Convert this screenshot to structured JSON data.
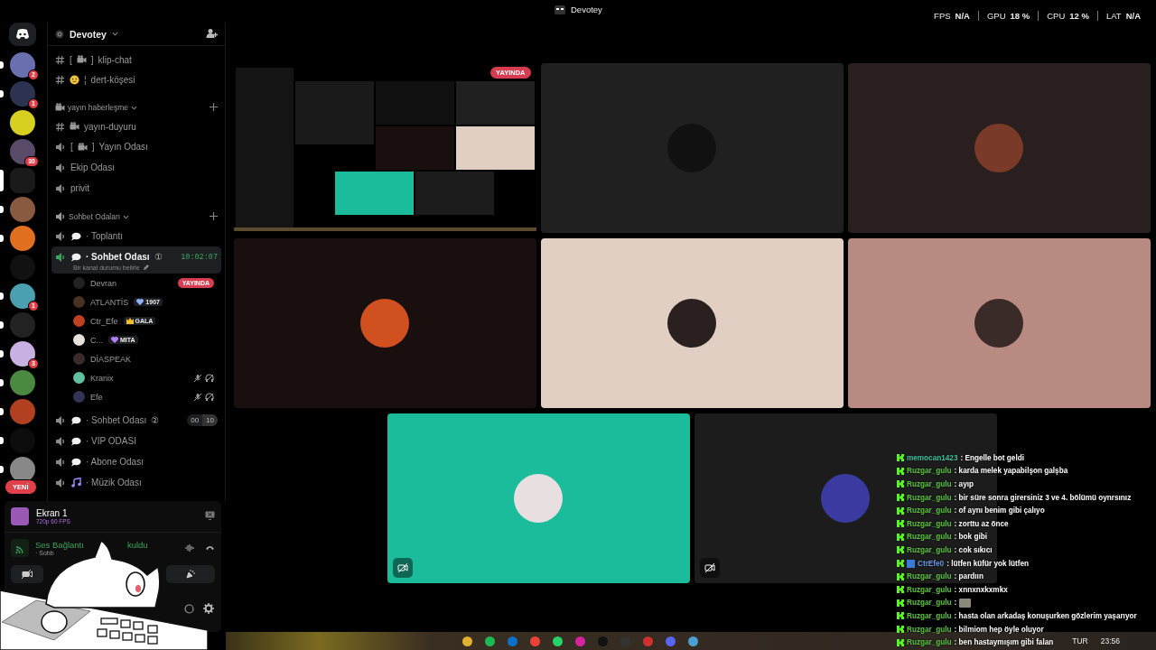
{
  "title_bar": {
    "title": "Devotey",
    "stats": [
      {
        "label": "FPS",
        "value": "N/A"
      },
      {
        "label": "GPU",
        "value": "18 %"
      },
      {
        "label": "CPU",
        "value": "12 %"
      },
      {
        "label": "LAT",
        "value": "N/A"
      }
    ]
  },
  "servers": [
    {
      "color": "#6a6fb0",
      "badge": "2",
      "unread": true,
      "selected": false
    },
    {
      "color": "#2b3350",
      "badge": "1",
      "unread": true,
      "selected": false
    },
    {
      "color": "#d8d020",
      "unread": false,
      "selected": false
    },
    {
      "color": "#5a4a6a",
      "badge": "30",
      "unread": false,
      "selected": false
    },
    {
      "color": "#1a1a1a",
      "unread": false,
      "selected": true
    },
    {
      "color": "#8a5a40",
      "unread": true,
      "selected": false
    },
    {
      "color": "#e07020",
      "unread": true,
      "selected": false
    },
    {
      "color": "#111111",
      "unread": false,
      "selected": false
    },
    {
      "color": "#4aa0b0",
      "badge": "1",
      "unread": true,
      "selected": false
    },
    {
      "color": "#222222",
      "unread": true,
      "selected": false
    },
    {
      "color": "#c8b0e0",
      "badge": "3",
      "unread": true,
      "selected": false
    },
    {
      "color": "#4a8a40",
      "unread": true,
      "selected": false
    },
    {
      "color": "#b04020",
      "unread": true,
      "selected": false
    },
    {
      "color": "#0c0c0c",
      "unread": true,
      "selected": false
    },
    {
      "color": "#888888",
      "unread": true,
      "selected": false
    }
  ],
  "new_label": "YENİ",
  "server": {
    "name": "Devotey"
  },
  "channels": [
    {
      "kind": "text",
      "prefix": "[",
      "emblem": {
        "kind": "camera"
      },
      "infix": "]",
      "name": "klip-chat"
    },
    {
      "kind": "text",
      "emblem": {
        "kind": "smiley"
      },
      "infix": "¦",
      "name": "dert-köşesi"
    },
    {
      "kind": "category",
      "emblem": {
        "kind": "camera"
      },
      "name": "yayın haberleşme",
      "expanded": true
    },
    {
      "kind": "text",
      "emblem": {
        "kind": "camera"
      },
      "name": "yayın-duyuru"
    },
    {
      "kind": "voice",
      "prefix": "[",
      "emblem": {
        "kind": "camera"
      },
      "infix": "]",
      "name": "Yayın Odası",
      "selected": false
    },
    {
      "kind": "voice",
      "name": "Ekip Odası",
      "selected": false
    },
    {
      "kind": "voice",
      "name": "privit",
      "selected": false
    },
    {
      "kind": "category",
      "emblem": {
        "kind": "speaker"
      },
      "name": "Sohbet Odaları",
      "expanded": true
    },
    {
      "kind": "voice",
      "emblem": {
        "kind": "chat"
      },
      "name": "· Toplantı",
      "selected": false
    },
    {
      "kind": "voice",
      "emblem": {
        "kind": "chat"
      },
      "name": "· Sohbet Odası",
      "mark": "①",
      "timer": "10:02:07",
      "status": "Bir kanal durumu belirle",
      "selected": true
    },
    {
      "kind": "user",
      "name": "Devran",
      "live": "YAYINDA",
      "muted": false,
      "deafened": false
    },
    {
      "kind": "user",
      "name": "ATLANTİS",
      "tag": "1907",
      "tag_emblem": {
        "kind": "heart",
        "color": "#8fb0ff"
      },
      "muted": false,
      "deafened": false
    },
    {
      "kind": "user",
      "name": "Ctr_Efe",
      "tag": "GALA",
      "tag_emblem": {
        "kind": "crown",
        "color": "#f0c030"
      },
      "muted": false,
      "deafened": false
    },
    {
      "kind": "user",
      "name": "C...",
      "tag": "MITA",
      "tag_emblem": {
        "kind": "heart",
        "color": "#b080ff"
      },
      "muted": false,
      "deafened": false
    },
    {
      "kind": "user",
      "name": "DİASPEAK",
      "muted": false,
      "deafened": false
    },
    {
      "kind": "user",
      "name": "Kranix",
      "muted": true,
      "deafened": true
    },
    {
      "kind": "user",
      "name": "Efe",
      "muted": true,
      "deafened": true
    },
    {
      "kind": "voice",
      "emblem": {
        "kind": "chat"
      },
      "name": "· Sohbet Odası",
      "mark": "②",
      "counts": [
        "00",
        "10"
      ],
      "selected": false
    },
    {
      "kind": "voice",
      "emblem": {
        "kind": "chat"
      },
      "name": "· VIP ODASI",
      "selected": false
    },
    {
      "kind": "voice",
      "emblem": {
        "kind": "chat"
      },
      "name": "· Abone Odası",
      "selected": false
    },
    {
      "kind": "voice",
      "emblem": {
        "kind": "music"
      },
      "name": "· Müzik Odası",
      "selected": false
    }
  ],
  "stream_panel": {
    "title": "Ekran 1",
    "quality": "720p 60 FPS"
  },
  "voice_panel": {
    "status_start": "Ses Bağlantı",
    "status_end": "kuldu",
    "channel": "· Sohb"
  },
  "tiles": [
    {
      "kind": "screen",
      "live": "YAYINDA",
      "camera_off": false
    },
    {
      "kind": "avatar",
      "color": "#202020",
      "avatar": {
        "color": "#111111"
      },
      "camera_off": false
    },
    {
      "kind": "avatar",
      "color": "#2a1f1f",
      "avatar": {
        "color": "#7a3a2a"
      },
      "camera_off": false
    },
    {
      "kind": "avatar",
      "color": "#1a0f0f",
      "avatar": {
        "color": "#d05020"
      },
      "camera_off": false
    },
    {
      "kind": "avatar",
      "color": "#e2cfc4",
      "avatar": {
        "color": "#2a2020"
      },
      "camera_off": false
    },
    {
      "kind": "avatar",
      "color": "#b98a82",
      "avatar": {
        "color": "#3a2a28"
      },
      "camera_off": false
    },
    {
      "kind": "avatar",
      "color": "#1abc9c",
      "avatar": {
        "color": "#e8e0e0"
      },
      "camera_off": true
    },
    {
      "kind": "avatar",
      "color": "#1c1c1c",
      "avatar": {
        "color": "#3a3aa0"
      },
      "camera_off": true
    }
  ],
  "chat": [
    {
      "user": "memocan1423",
      "color": "#40c0a0",
      "mod": false,
      "text": ": Engelle bot geldi"
    },
    {
      "user": "Ruzgar_gulu",
      "color": "#5cc83c",
      "mod": false,
      "text": ": karda melek yapabilşon galşba"
    },
    {
      "user": "Ruzgar_gulu",
      "color": "#5cc83c",
      "mod": false,
      "text": ": ayıp"
    },
    {
      "user": "Ruzgar_gulu",
      "color": "#5cc83c",
      "mod": false,
      "text": ": bir süre sonra girersiniz 3 ve 4. bölümü oynrsınız"
    },
    {
      "user": "Ruzgar_gulu",
      "color": "#5cc83c",
      "mod": false,
      "text": ": of aynı benim gibi çalıyo"
    },
    {
      "user": "Ruzgar_gulu",
      "color": "#5cc83c",
      "mod": false,
      "text": ": zorttu az önce"
    },
    {
      "user": "Ruzgar_gulu",
      "color": "#5cc83c",
      "mod": false,
      "text": ": bok gibi"
    },
    {
      "user": "Ruzgar_gulu",
      "color": "#5cc83c",
      "mod": false,
      "text": ": cok sıkıcı"
    },
    {
      "user": "CtrEfe0",
      "color": "#6a9ae8",
      "mod": true,
      "text": ": lütfen küfür yok lütfen"
    },
    {
      "user": "Ruzgar_gulu",
      "color": "#5cc83c",
      "mod": false,
      "text": ": pardıın"
    },
    {
      "user": "Ruzgar_gulu",
      "color": "#5cc83c",
      "mod": false,
      "text": ": xnnxnxkxmkx"
    },
    {
      "user": "Ruzgar_gulu",
      "color": "#5cc83c",
      "mod": false,
      "text": ":",
      "sticker": true
    },
    {
      "user": "Ruzgar_gulu",
      "color": "#5cc83c",
      "mod": false,
      "text": ": hasta olan arkadaş konuşurken gözlerim yaşarıyor"
    },
    {
      "user": "Ruzgar_gulu",
      "color": "#5cc83c",
      "mod": false,
      "text": ": bilmiom hep öyle oluyor"
    },
    {
      "user": "Ruzgar_gulu",
      "color": "#5cc83c",
      "mod": false,
      "text": ": ben hastaymışım gibi falan"
    }
  ],
  "taskbar": {
    "language": "TUR",
    "time": "23:56"
  }
}
